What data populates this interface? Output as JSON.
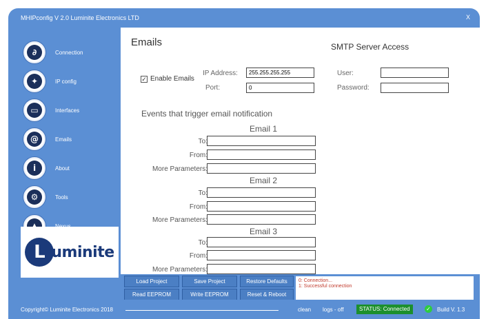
{
  "window": {
    "title": "MHIPconfig V 2.0   Luminite Electronics LTD",
    "close_label": "X"
  },
  "sidebar": {
    "items": [
      {
        "label": "Connection",
        "icon": "link-icon",
        "glyph": "∂"
      },
      {
        "label": "IP config",
        "icon": "network-icon",
        "glyph": "✦"
      },
      {
        "label": "Interfaces",
        "icon": "monitor-icon",
        "glyph": "▭"
      },
      {
        "label": "Emails",
        "icon": "at-icon",
        "glyph": "@"
      },
      {
        "label": "About",
        "icon": "info-icon",
        "glyph": "i"
      },
      {
        "label": "Tools",
        "icon": "gear-icon",
        "glyph": "⚙"
      },
      {
        "label": "Nexus",
        "icon": "warning-icon",
        "glyph": "▲"
      }
    ],
    "logo": {
      "badge": "L",
      "text": "uminite"
    }
  },
  "main": {
    "title": "Emails",
    "smtp_title": "SMTP Server Access",
    "enable_emails": {
      "label": "Enable Emails",
      "checked": true,
      "check_glyph": "✓"
    },
    "ip_address": {
      "label": "IP Address:",
      "value": "255.255.255.255"
    },
    "port": {
      "label": "Port:",
      "value": "0"
    },
    "user": {
      "label": "User:",
      "value": ""
    },
    "password": {
      "label": "Password:",
      "value": ""
    },
    "events_title": "Events that trigger email notification",
    "emails": [
      {
        "heading": "Email 1",
        "to_label": "To:",
        "from_label": "From:",
        "more_label": "More Parameters:"
      },
      {
        "heading": "Email 2",
        "to_label": "To:",
        "from_label": "From:",
        "more_label": "More Parameters:"
      },
      {
        "heading": "Email 3",
        "to_label": "To:",
        "from_label": "From:",
        "more_label": "More Parameters:"
      }
    ]
  },
  "buttons": {
    "load_project": "Load Project",
    "save_project": "Save Project",
    "restore_defaults": "Restore Defaults",
    "read_eeprom": "Read EEPROM",
    "write_eeprom": "Write EEPROM",
    "reset_reboot": "Reset & Reboot"
  },
  "log": {
    "lines": [
      "0: Connection...",
      "1: Successful connection"
    ]
  },
  "statusbar": {
    "copyright": "Copyright© Luminite Electronics 2018",
    "clean": "clean",
    "logs": "logs - off",
    "status": "STATUS: Connected",
    "build": "Build V. 1.3"
  },
  "colors": {
    "accent": "#5b8fd4",
    "status_ok": "#1c8f2d",
    "log_text": "#c0392b"
  }
}
